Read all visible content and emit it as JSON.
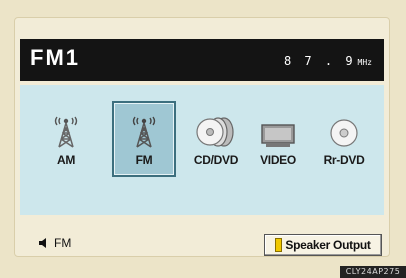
{
  "header": {
    "title": "FM1",
    "frequency": "8 7 . 9",
    "frequency_unit": "MHz"
  },
  "sources": [
    {
      "label": "AM",
      "icon": "tower-icon",
      "selected": false
    },
    {
      "label": "FM",
      "icon": "tower-icon",
      "selected": true
    },
    {
      "label": "CD/DVD",
      "icon": "discs-icon",
      "selected": false
    },
    {
      "label": "VIDEO",
      "icon": "monitor-icon",
      "selected": false
    },
    {
      "label": "Rr-DVD",
      "icon": "disc-icon",
      "selected": false
    }
  ],
  "footer": {
    "volume_source": "FM",
    "volume_icon": "speaker-icon",
    "speaker_output_label": "Speaker Output"
  },
  "figure_code": "CLY24AP275",
  "colors": {
    "header_bg": "#141414",
    "panel_bg": "#cde7ec",
    "selected_bg": "#9fc7d3",
    "indicator": "#f0c800"
  }
}
